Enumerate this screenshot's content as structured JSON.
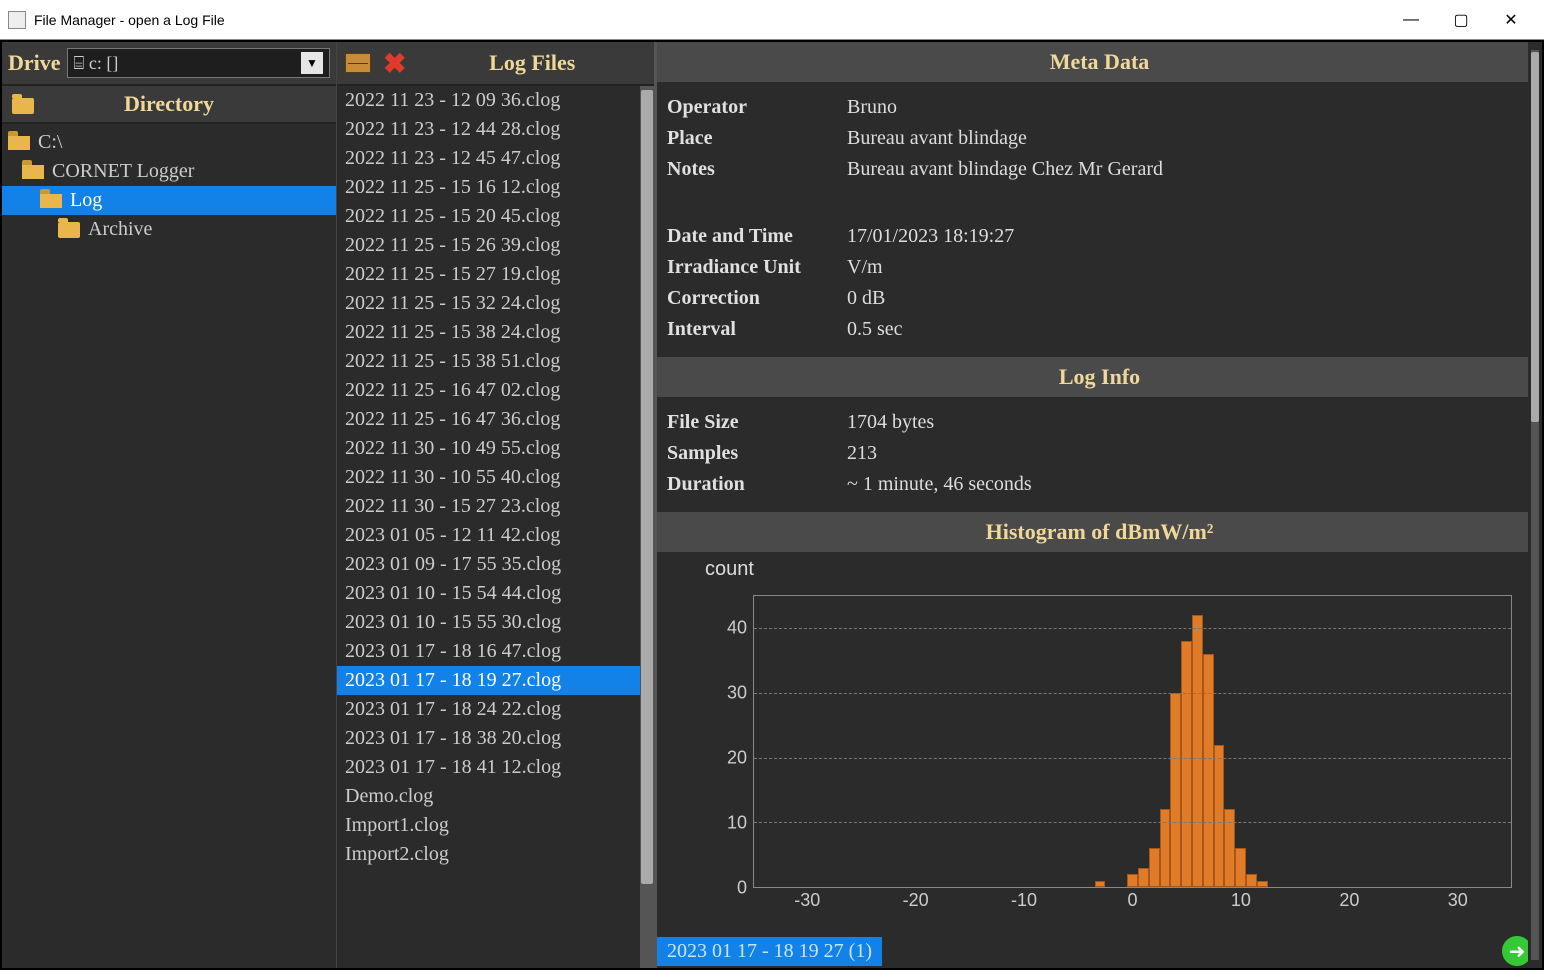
{
  "window": {
    "title": "File Manager - open a Log File",
    "minimize": "—",
    "maximize": "▢",
    "close": "✕"
  },
  "drive": {
    "label": "Drive",
    "value": "⌸ c: []"
  },
  "directory": {
    "header": "Directory",
    "tree": [
      {
        "label": "C:\\",
        "indent": 0,
        "icon": "folder-open"
      },
      {
        "label": "CORNET Logger",
        "indent": 1,
        "icon": "folder-open"
      },
      {
        "label": "Log",
        "indent": 2,
        "icon": "folder-open",
        "selected": true
      },
      {
        "label": "Archive",
        "indent": 3,
        "icon": "folder"
      }
    ]
  },
  "files": {
    "header": "Log Files",
    "items": [
      "2022 11 23 - 12 09 36.clog",
      "2022 11 23 - 12 44 28.clog",
      "2022 11 23 - 12 45 47.clog",
      "2022 11 25 - 15 16 12.clog",
      "2022 11 25 - 15 20 45.clog",
      "2022 11 25 - 15 26 39.clog",
      "2022 11 25 - 15 27 19.clog",
      "2022 11 25 - 15 32 24.clog",
      "2022 11 25 - 15 38 24.clog",
      "2022 11 25 - 15 38 51.clog",
      "2022 11 25 - 16 47 02.clog",
      "2022 11 25 - 16 47 36.clog",
      "2022 11 30 - 10 49 55.clog",
      "2022 11 30 - 10 55 40.clog",
      "2022 11 30 - 15 27 23.clog",
      "2023 01 05 - 12 11 42.clog",
      "2023 01 09 - 17 55 35.clog",
      "2023 01 10 - 15 54 44.clog",
      "2023 01 10 - 15 55 30.clog",
      "2023 01 17 - 18 16 47.clog",
      "2023 01 17 - 18 19 27.clog",
      "2023 01 17 - 18 24 22.clog",
      "2023 01 17 - 18 38 20.clog",
      "2023 01 17 - 18 41 12.clog",
      "Demo.clog",
      "Import1.clog",
      "Import2.clog"
    ],
    "selected_index": 20
  },
  "meta": {
    "header": "Meta Data",
    "rows": [
      {
        "label": "Operator",
        "value": "Bruno"
      },
      {
        "label": "Place",
        "value": "Bureau avant blindage"
      },
      {
        "label": "Notes",
        "value": "Bureau avant blindage Chez Mr Gerard"
      }
    ],
    "rows2": [
      {
        "label": "Date and Time",
        "value": "17/01/2023 18:19:27"
      },
      {
        "label": "Irradiance Unit",
        "value": "V/m"
      },
      {
        "label": "Correction",
        "value": "0 dB"
      },
      {
        "label": "Interval",
        "value": "0.5 sec"
      }
    ]
  },
  "loginfo": {
    "header": "Log Info",
    "rows": [
      {
        "label": "File Size",
        "value": "1704 bytes"
      },
      {
        "label": "Samples",
        "value": "213"
      },
      {
        "label": "Duration",
        "value": "~ 1 minute, 46 seconds"
      }
    ]
  },
  "histogram": {
    "header": "Histogram of dBmW/m²",
    "ylabel": "count"
  },
  "status": {
    "text": "2023 01 17 - 18 19 27 (1)"
  },
  "chart_data": {
    "type": "bar",
    "title": "Histogram of dBmW/m²",
    "xlabel": "",
    "ylabel": "count",
    "xlim": [
      -35,
      35
    ],
    "ylim": [
      0,
      45
    ],
    "xticks": [
      -30,
      -20,
      -10,
      0,
      10,
      20,
      30
    ],
    "yticks": [
      0,
      10,
      20,
      30,
      40
    ],
    "categories": [
      -3,
      -2,
      -1,
      0,
      1,
      2,
      3,
      4,
      5,
      6,
      7,
      8,
      9,
      10,
      11,
      12
    ],
    "values": [
      1,
      0,
      0,
      2,
      3,
      6,
      12,
      30,
      38,
      42,
      36,
      22,
      12,
      6,
      2,
      1
    ]
  }
}
